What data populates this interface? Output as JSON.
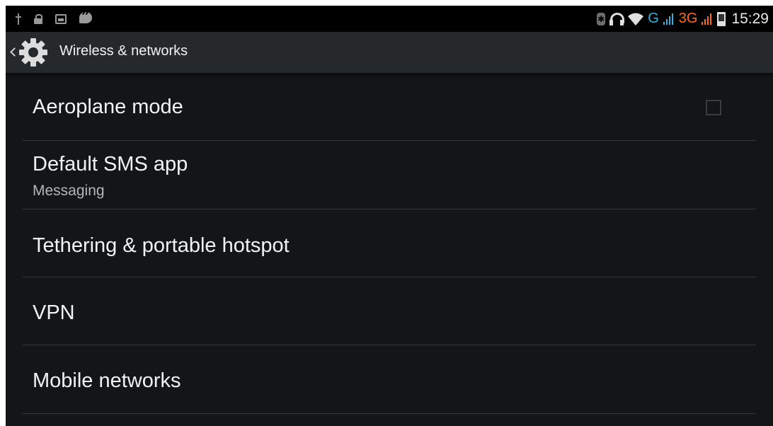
{
  "status_bar": {
    "left_icons": [
      "usb-icon",
      "lock-icon",
      "image-icon",
      "hangouts-icon"
    ],
    "right_icons": [
      "bluetooth-icon",
      "headset-icon",
      "wifi-icon",
      "signal-icon",
      "signal-icon",
      "battery-icon"
    ],
    "network_type_1": "G",
    "network_type_2": "3G",
    "time": "15:29",
    "colors": {
      "g_color": "#31b5e5",
      "three_g_color": "#ff6a1a"
    }
  },
  "action_bar": {
    "title": "Wireless & networks",
    "icon": "gear-icon",
    "back_icon": "chevron-left-icon"
  },
  "preferences": [
    {
      "title": "Aeroplane mode",
      "summary": "",
      "checked": false
    },
    {
      "title": "Default SMS app",
      "summary": "Messaging"
    },
    {
      "title": "Tethering & portable hotspot",
      "summary": ""
    },
    {
      "title": "VPN",
      "summary": ""
    },
    {
      "title": "Mobile networks",
      "summary": ""
    }
  ]
}
